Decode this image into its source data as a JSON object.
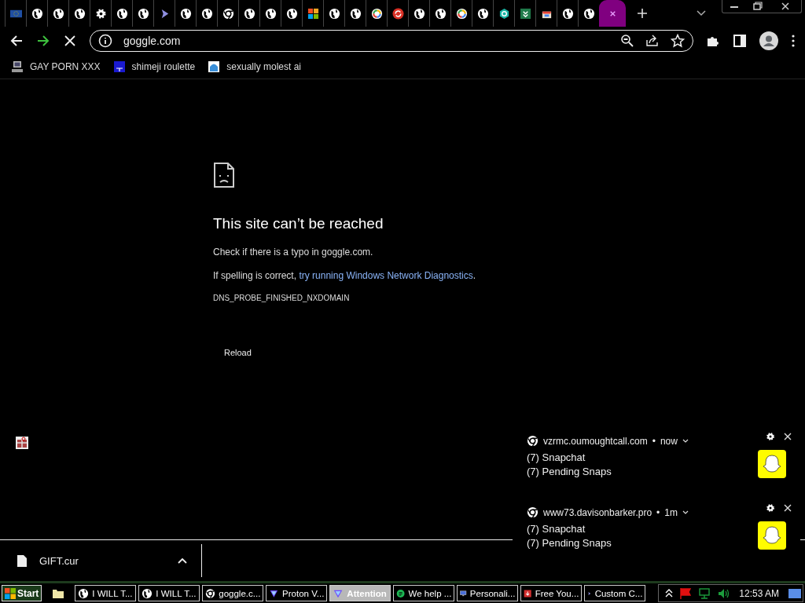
{
  "tabs": [
    {
      "kind": "flag",
      "selected": false
    },
    {
      "kind": "globe",
      "selected": false
    },
    {
      "kind": "globe",
      "selected": false
    },
    {
      "kind": "globe",
      "selected": false
    },
    {
      "kind": "gear",
      "selected": false
    },
    {
      "kind": "globe",
      "selected": false
    },
    {
      "kind": "globe",
      "selected": false
    },
    {
      "kind": "cursor",
      "selected": false
    },
    {
      "kind": "globe",
      "selected": false
    },
    {
      "kind": "globe",
      "selected": false
    },
    {
      "kind": "chrome",
      "selected": false
    },
    {
      "kind": "globe",
      "selected": false
    },
    {
      "kind": "globe",
      "selected": false
    },
    {
      "kind": "globe",
      "selected": false
    },
    {
      "kind": "squares",
      "selected": false
    },
    {
      "kind": "globe",
      "selected": false
    },
    {
      "kind": "globe",
      "selected": false
    },
    {
      "kind": "ring",
      "selected": false
    },
    {
      "kind": "refresh",
      "selected": false
    },
    {
      "kind": "globe",
      "selected": false
    },
    {
      "kind": "globe",
      "selected": false
    },
    {
      "kind": "ring",
      "selected": false
    },
    {
      "kind": "globe",
      "selected": false
    },
    {
      "kind": "hexagon",
      "selected": false
    },
    {
      "kind": "chevrons",
      "selected": false
    },
    {
      "kind": "shop",
      "selected": false
    },
    {
      "kind": "globe",
      "selected": false
    },
    {
      "kind": "globe",
      "selected": false
    },
    {
      "kind": "close",
      "selected": true
    }
  ],
  "address": {
    "url": "goggle.com"
  },
  "bookmarks": [
    {
      "kind": "computer",
      "label": "GAY PORN XXX"
    },
    {
      "kind": "square",
      "label": "shimeji roulette"
    },
    {
      "kind": "app",
      "label": "sexually molest ai"
    }
  ],
  "error": {
    "title": "This site can’t be reached",
    "hint": "Check if there is a typo in goggle.com.",
    "prefix": "If spelling is correct, ",
    "link": "try running Windows Network Diagnostics",
    "suffix": ".",
    "code": "DNS_PROBE_FINISHED_NXDOMAIN",
    "button": "Reload"
  },
  "notifications": [
    {
      "site": "vzrmc.oumoughtcall.com",
      "sep": "•",
      "time": "now",
      "title": "(7) Snapchat",
      "body": "(7) Pending Snaps"
    },
    {
      "site": "www73.davisonbarker.pro",
      "sep": "•",
      "time": "1m",
      "title": "(7) Snapchat",
      "body": "(7) Pending Snaps"
    }
  ],
  "download": {
    "file": "GIFT.cur"
  },
  "taskbar": {
    "start": "Start",
    "items": [
      {
        "kind": "globe",
        "label": "I WILL T...",
        "flashing": false
      },
      {
        "kind": "globe",
        "label": "I WILL T...",
        "flashing": false
      },
      {
        "kind": "chrome",
        "label": "goggle.c...",
        "flashing": false
      },
      {
        "kind": "proton",
        "label": "Proton V...",
        "flashing": false
      },
      {
        "kind": "proton",
        "label": "Attention",
        "flashing": true
      },
      {
        "kind": "chat",
        "label": "We help ...",
        "flashing": false
      },
      {
        "kind": "monitor",
        "label": "Personali...",
        "flashing": false
      },
      {
        "kind": "download",
        "label": "Free You...",
        "flashing": false
      },
      {
        "kind": "cursor",
        "label": "Custom C...",
        "flashing": false
      }
    ],
    "clock": "12:53 AM"
  }
}
